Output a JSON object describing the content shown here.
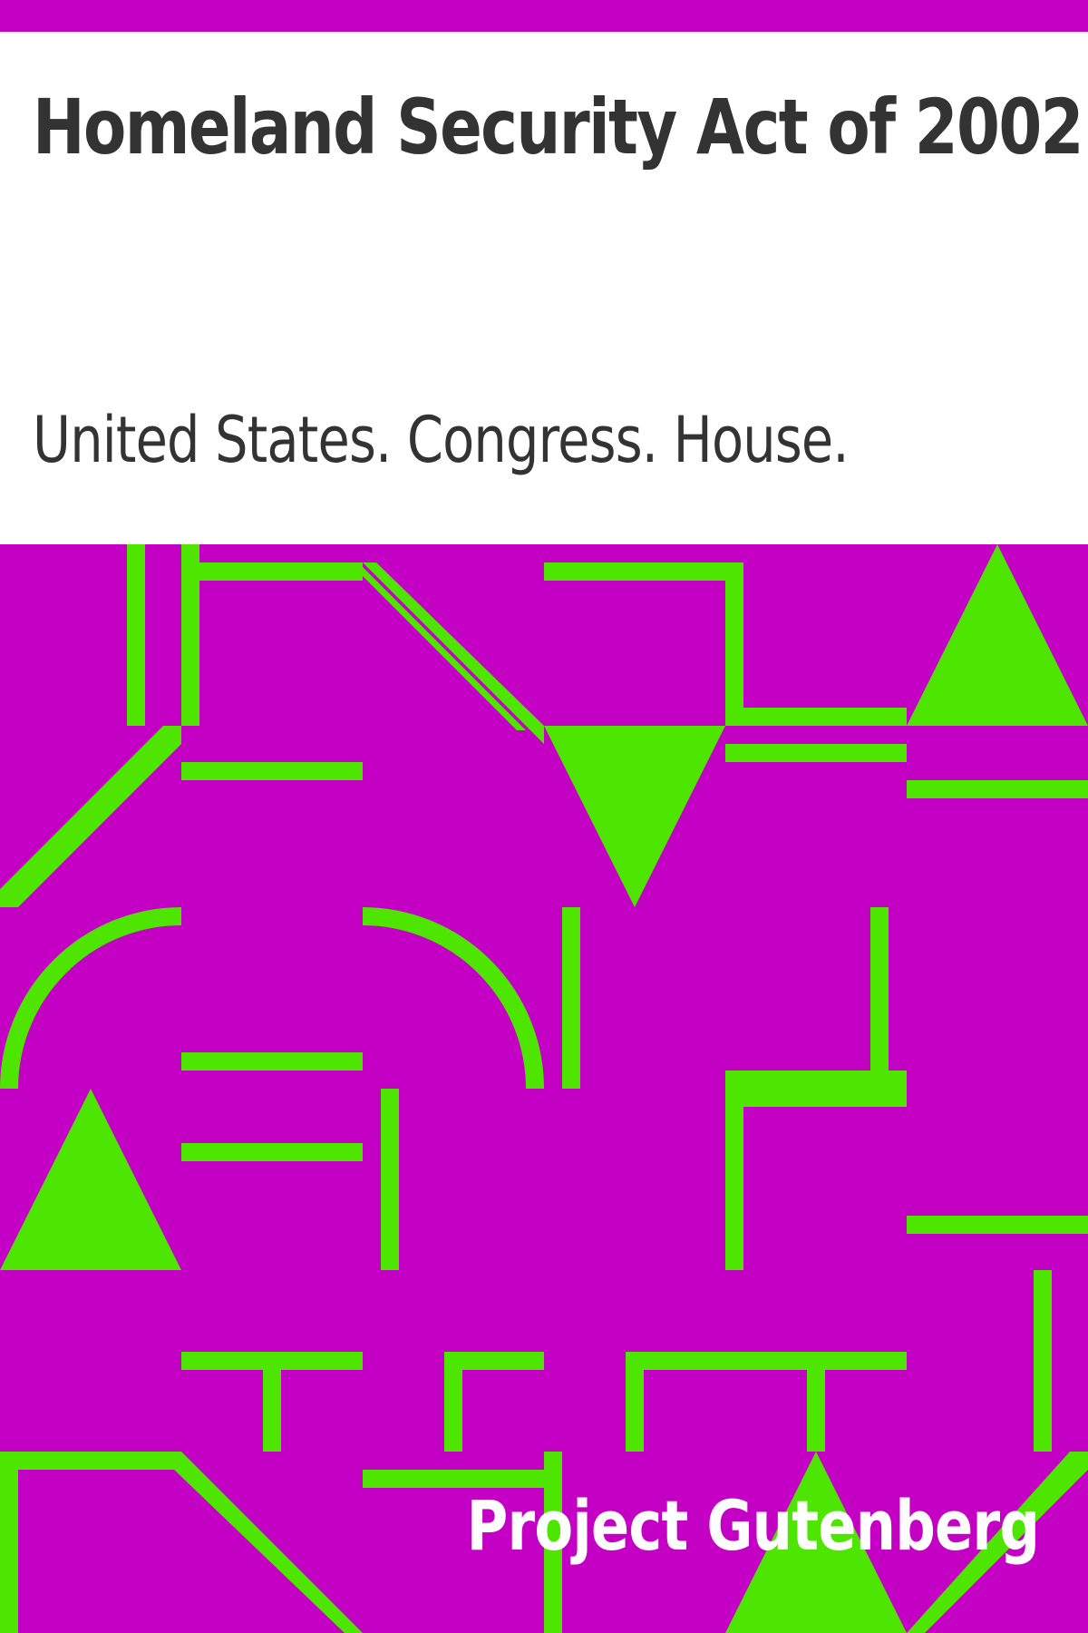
{
  "cover": {
    "title": "Homeland Security Act of 2002",
    "author": "United States. Congress. House.",
    "publisher": "Project Gutenberg"
  },
  "colors": {
    "background": "#ffffff",
    "band": "#c300c3",
    "pattern": "#4ee600",
    "title_text": "#333333",
    "publisher_text": "#ffffff"
  }
}
